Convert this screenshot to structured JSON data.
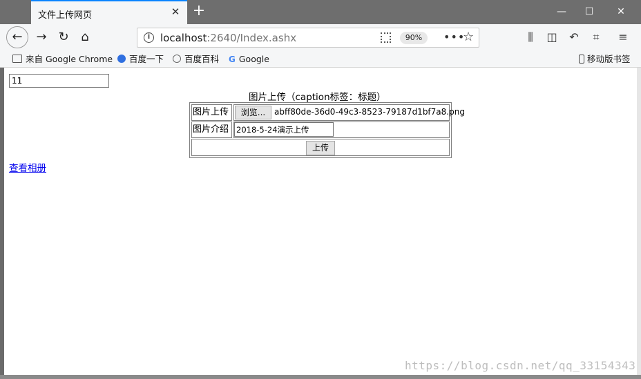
{
  "browser": {
    "tab_title": "文件上传网页",
    "tab_close": "✕",
    "new_tab": "+",
    "window_controls": {
      "minimize": "—",
      "maximize": "☐",
      "close": "✕"
    },
    "url_host": "localhost",
    "url_rest": ":2640/Index.ashx",
    "zoom": "90%",
    "more": "•••",
    "star": "☆"
  },
  "bookmarks": {
    "items": [
      {
        "label": "来自 Google Chrome",
        "icon": "folder-icon"
      },
      {
        "label": "百度一下",
        "icon": "baidu-paw-icon"
      },
      {
        "label": "百度百科",
        "icon": "globe-icon"
      },
      {
        "label": "Google",
        "icon": "google-g-icon"
      }
    ],
    "mobile": "移动版书签"
  },
  "page": {
    "top_input_value": "11",
    "caption": "图片上传（caption标签：标题）",
    "rows": {
      "upload_label": "图片上传",
      "browse_label": "浏览...",
      "filename": "abff80de-36d0-49c3-8523-79187d1bf7a8.png",
      "desc_label": "图片介绍",
      "desc_value": "2018-5-24演示上传",
      "submit_label": "上传"
    },
    "album_link": "查看相册"
  },
  "watermark": "https://blog.csdn.net/qq_33154343"
}
